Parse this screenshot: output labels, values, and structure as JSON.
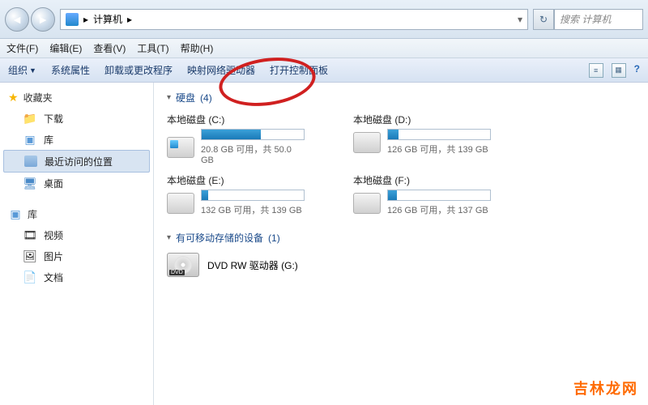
{
  "address": {
    "location": "计算机",
    "sep": "▸"
  },
  "search": {
    "placeholder": "搜索 计算机"
  },
  "menubar": [
    "文件(F)",
    "编辑(E)",
    "查看(V)",
    "工具(T)",
    "帮助(H)"
  ],
  "toolbar": {
    "organize": "组织",
    "items": [
      "系统属性",
      "卸载或更改程序",
      "映射网络驱动器",
      "打开控制面板"
    ]
  },
  "sidebar": {
    "favorites": {
      "title": "收藏夹",
      "items": [
        "下载",
        "库",
        "最近访问的位置",
        "桌面"
      ]
    },
    "libraries": {
      "title": "库",
      "items": [
        "视频",
        "图片",
        "文档"
      ]
    }
  },
  "content": {
    "hdd_section": {
      "title": "硬盘",
      "count": "(4)"
    },
    "drives": [
      {
        "name": "本地磁盘 (C:)",
        "info": "20.8 GB 可用，共 50.0 GB",
        "fill": 58,
        "c": true
      },
      {
        "name": "本地磁盘 (D:)",
        "info": "126 GB 可用，共 139 GB",
        "fill": 10
      },
      {
        "name": "本地磁盘 (E:)",
        "info": "132 GB 可用，共 139 GB",
        "fill": 6
      },
      {
        "name": "本地磁盘 (F:)",
        "info": "126 GB 可用，共 137 GB",
        "fill": 9
      }
    ],
    "removable_section": {
      "title": "有可移动存储的设备",
      "count": "(1)"
    },
    "dvd": {
      "name": "DVD RW 驱动器 (G:)",
      "tag": "DVD"
    }
  },
  "watermark": "吉林龙网"
}
